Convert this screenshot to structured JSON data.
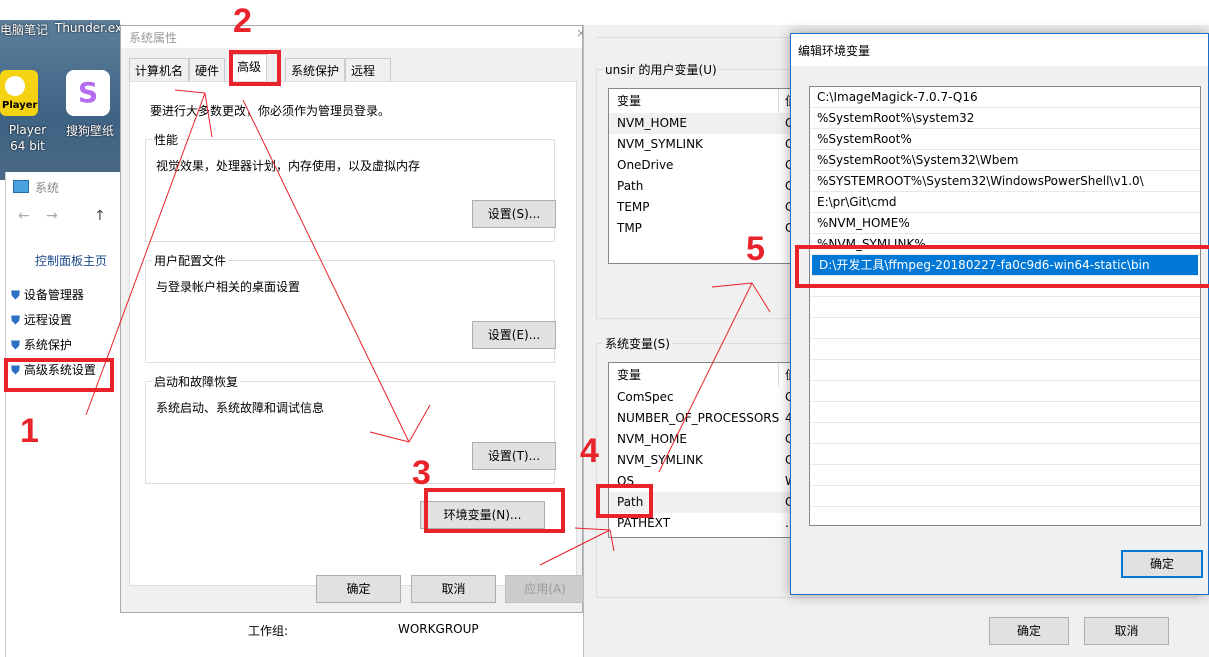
{
  "desktop": {
    "top_labels": [
      "电脑笔记",
      "Thunder.ex"
    ],
    "icons": [
      {
        "label": "Player 64 bit",
        "badge": "Player"
      },
      {
        "label": "搜狗壁纸"
      }
    ]
  },
  "system_window": {
    "title": "系统",
    "nav": {
      "home": "控制面板主页"
    },
    "links": [
      "设备管理器",
      "远程设置",
      "系统保护",
      "高级系统设置"
    ],
    "workgroup_label": "工作组:",
    "workgroup_value": "WORKGROUP"
  },
  "system_properties": {
    "title": "系统属性",
    "tabs": [
      "计算机名",
      "硬件",
      "高级",
      "系统保护",
      "远程"
    ],
    "active_tab": "高级",
    "notice": "要进行大多数更改，你必须作为管理员登录。",
    "groups": [
      {
        "title": "性能",
        "desc": "视觉效果，处理器计划，内存使用，以及虚拟内存",
        "button": "设置(S)..."
      },
      {
        "title": "用户配置文件",
        "desc": "与登录帐户相关的桌面设置",
        "button": "设置(E)..."
      },
      {
        "title": "启动和故障恢复",
        "desc": "系统启动、系统故障和调试信息",
        "button": "设置(T)..."
      }
    ],
    "env_button": "环境变量(N)...",
    "ok": "确定",
    "cancel": "取消",
    "apply": "应用(A)"
  },
  "env_vars": {
    "user_group": "unsir 的用户变量(U)",
    "column": "变量",
    "column2": "值",
    "user_vars": [
      "NVM_HOME",
      "NVM_SYMLINK",
      "OneDrive",
      "Path",
      "TEMP",
      "TMP"
    ],
    "user_value_glyphs": [
      "C",
      "C",
      "C",
      "C",
      "C",
      "C"
    ],
    "system_group": "系统变量(S)",
    "system_vars": [
      "ComSpec",
      "NUMBER_OF_PROCESSORS",
      "NVM_HOME",
      "NVM_SYMLINK",
      "OS",
      "Path",
      "PATHEXT"
    ],
    "system_value_glyphs": [
      "C",
      "4",
      "C",
      "C",
      "W",
      "C",
      "."
    ],
    "ok": "确定",
    "cancel": "取消"
  },
  "edit_env": {
    "title": "编辑环境变量",
    "entries": [
      "C:\\ImageMagick-7.0.7-Q16",
      "%SystemRoot%\\system32",
      "%SystemRoot%",
      "%SystemRoot%\\System32\\Wbem",
      "%SYSTEMROOT%\\System32\\WindowsPowerShell\\v1.0\\",
      "E:\\pr\\Git\\cmd",
      "%NVM_HOME%",
      "%NVM_SYMLINK%",
      "D:\\开发工具\\ffmpeg-20180227-fa0c9d6-win64-static\\bin"
    ],
    "selected_index": 8,
    "ok": "确定"
  },
  "annotations": {
    "steps": [
      "1",
      "2",
      "3",
      "4",
      "5"
    ],
    "color": "#e8232b"
  },
  "colors": {
    "selection": "#0078d7",
    "annotation": "#e8232b"
  }
}
